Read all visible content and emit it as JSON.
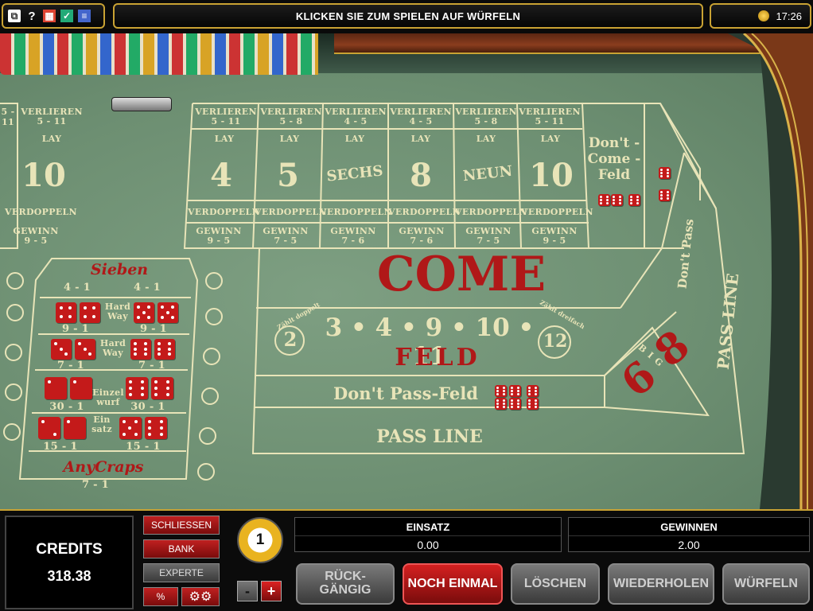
{
  "topbar": {
    "message": "KLICKEN SIE ZUM SPIELEN AUF WÜRFELN",
    "time": "17:26",
    "icons": [
      "windows-icon",
      "help-icon",
      "stats-icon",
      "check-icon",
      "settings-icon",
      "coin-icon"
    ]
  },
  "table": {
    "place_columns": [
      {
        "lose": "VERLIEREN",
        "lose_odds": "5 - 11",
        "lay": "LAY",
        "number": "10",
        "double": "VERDOPPELN",
        "win": "GEWINN",
        "win_odds": "9 - 5",
        "partial": true
      },
      {
        "lose": "VERLIEREN",
        "lose_odds": "5 - 11",
        "lay": "LAY",
        "number": "4",
        "double": "VERDOPPELN",
        "win": "GEWINN",
        "win_odds": "9 - 5"
      },
      {
        "lose": "VERLIEREN",
        "lose_odds": "5 - 8",
        "lay": "LAY",
        "number": "5",
        "double": "VERDOPPELN",
        "win": "GEWINN",
        "win_odds": "7 - 5"
      },
      {
        "lose": "VERLIEREN",
        "lose_odds": "4 - 5",
        "lay": "LAY",
        "number": "SECHS",
        "double": "VERDOPPELN",
        "win": "GEWINN",
        "win_odds": "7 - 6"
      },
      {
        "lose": "VERLIEREN",
        "lose_odds": "4 - 5",
        "lay": "LAY",
        "number": "8",
        "double": "VERDOPPELN",
        "win": "GEWINN",
        "win_odds": "7 - 6"
      },
      {
        "lose": "VERLIEREN",
        "lose_odds": "5 - 8",
        "lay": "LAY",
        "number": "NEUN",
        "double": "VERDOPPELN",
        "win": "GEWINN",
        "win_odds": "7 - 5"
      },
      {
        "lose": "VERLIEREN",
        "lose_odds": "5 - 11",
        "lay": "LAY",
        "number": "10",
        "double": "VERDOPPELN",
        "win": "GEWINN",
        "win_odds": "9 - 5"
      }
    ],
    "dont_come_feld": "Don't -Come -Feld",
    "dont_pass": "Don't Pass",
    "pass_line_right": "PASS LINE",
    "come": "COME",
    "field_numbers": "3 • 4 • 9 • 10 • 11",
    "field_two": "2",
    "field_twelve": "12",
    "zahlt_doppelt": "Zählt doppelt",
    "zahlt_dreifach": "Zählt dreifach",
    "feld": "FELD",
    "dont_pass_feld": "Don't Pass-Feld",
    "pass_line": "PASS LINE",
    "big_six": "6",
    "big_eight": "8",
    "big": "BIG",
    "props": {
      "sieben": "Sieben",
      "sieben_odds_left": "4 - 1",
      "sieben_odds_right": "4 - 1",
      "hard_way_1": "Hard Way",
      "hw1_left": "9 - 1",
      "hw1_right": "9 - 1",
      "hard_way_2": "Hard Way",
      "hw2_left": "7 - 1",
      "hw2_right": "7 - 1",
      "einzelwurf": "Einzel wurf",
      "ez_left": "30 - 1",
      "ez_right": "30 - 1",
      "einsatz": "Ein satz",
      "es_left": "15 - 1",
      "es_right": "15 - 1",
      "any_craps": "AnyCraps",
      "any_craps_odds": "7 - 1"
    }
  },
  "bottom": {
    "credits_label": "CREDITS",
    "credits_value": "318.38",
    "buttons": {
      "schliessen": "SCHLIESSEN",
      "bank": "BANK",
      "experte": "EXPERTE",
      "percent": "%",
      "settings": "gear"
    },
    "coin_value": "1",
    "minus": "-",
    "plus": "+",
    "einsatz_label": "EINSATZ",
    "einsatz_value": "0.00",
    "gewinnen_label": "GEWINNEN",
    "gewinnen_value": "2.00",
    "actions": {
      "rueckgaengig": "RÜCK- GÄNGIG",
      "noch_einmal": "NOCH EINMAL",
      "loeschen": "LÖSCHEN",
      "wiederholen": "WIEDERHOLEN",
      "wuerfeln": "WÜRFELN"
    }
  },
  "colors": {
    "felt": "#6d8f72",
    "line": "#e8e4b8",
    "red": "#b01818",
    "gold": "#c9a233"
  }
}
